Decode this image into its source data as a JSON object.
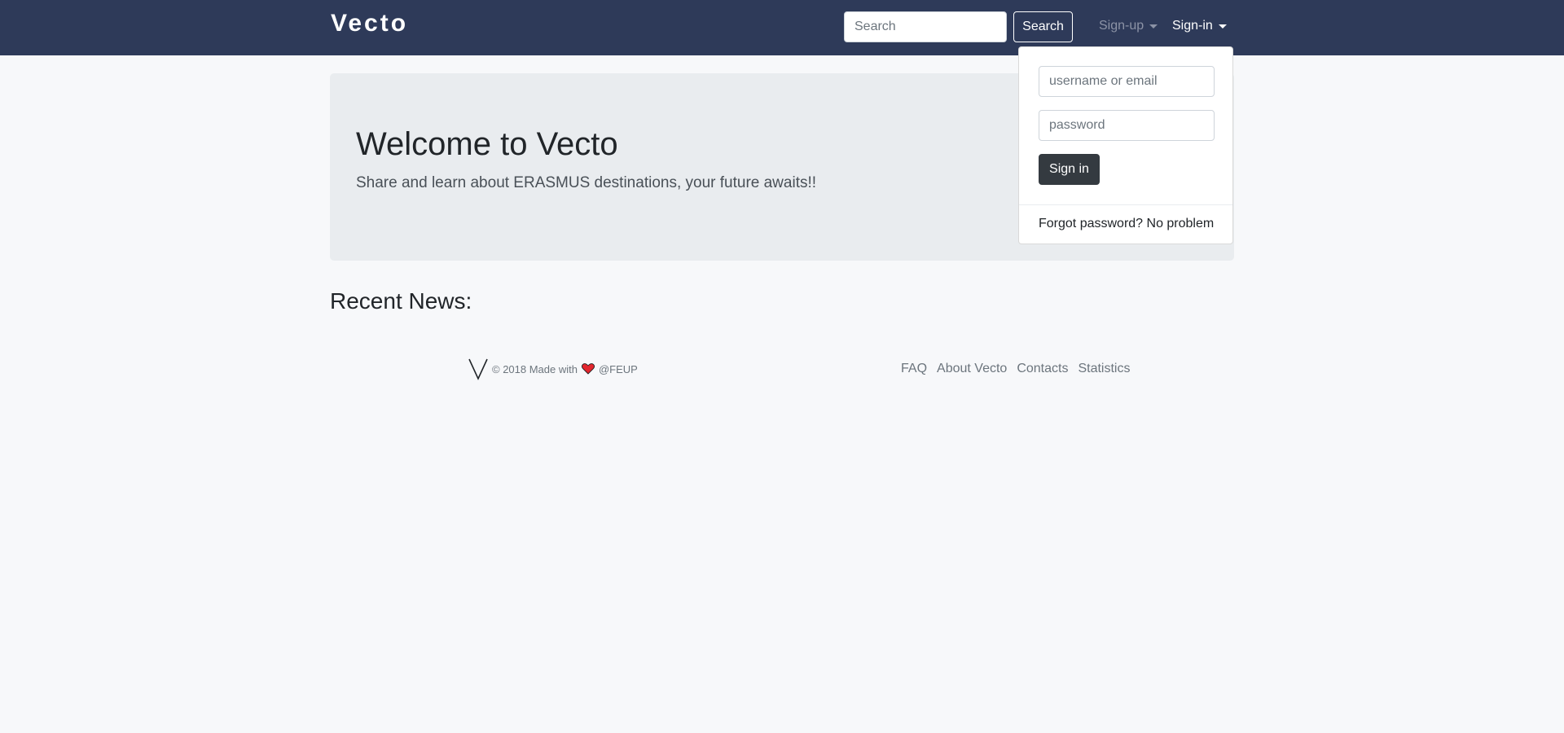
{
  "navbar": {
    "brand": "Vecto",
    "search": {
      "placeholder": "Search",
      "value": "",
      "button_label": "Search"
    },
    "signup_label": "Sign-up",
    "signin_label": "Sign-in"
  },
  "signin_dropdown": {
    "username_placeholder": "username or email",
    "password_placeholder": "password",
    "submit_label": "Sign in",
    "forgot_label": "Forgot password? No problem"
  },
  "jumbotron": {
    "title": "Welcome to Vecto",
    "lead": "Share and learn about ERASMUS destinations, your future awaits!!"
  },
  "main": {
    "recent_news_heading": "Recent News:"
  },
  "footer": {
    "copyright_prefix": "© 2018 Made with",
    "copyright_suffix": "@FEUP",
    "links": [
      "FAQ",
      "About Vecto",
      "Contacts",
      "Statistics"
    ]
  },
  "colors": {
    "navbar_bg": "#2e3a59",
    "jumbotron_bg": "#e9ecef",
    "page_bg": "#f7f8fa",
    "heart": "#e3262e"
  },
  "icons": [
    "vecto-logo-icon",
    "heart-icon",
    "caret-down-icon"
  ]
}
